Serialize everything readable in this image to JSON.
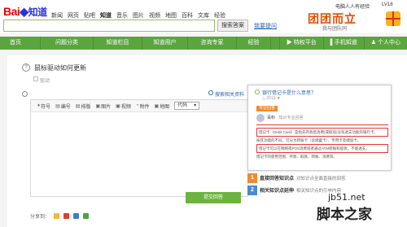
{
  "header": {
    "logo": {
      "part1": "Bai",
      "paw": "◆",
      "part2": "知道"
    },
    "nav": [
      "新闻",
      "网页",
      "贴吧",
      "知道",
      "音乐",
      "图片",
      "视频",
      "地图",
      "百科",
      "文库",
      "经验"
    ],
    "nav_active_index": 3,
    "search": {
      "value": "",
      "button_label": "搜索答案",
      "ask_link": "我要提问"
    },
    "user": {
      "name": "电脑人人有经验",
      "level": "LV18"
    },
    "promo": {
      "text": "团团而立",
      "sub": "我与团队同",
      "badge": "知道"
    }
  },
  "menubar": {
    "items": [
      "首页",
      "问题分类",
      "知道栏目",
      "知道用户",
      "咨询专家",
      "经验"
    ],
    "right_items": [
      "▶ 特权平台",
      "▌手机知道",
      "♟ 个人中心"
    ]
  },
  "question": {
    "icon": "?",
    "title": "鼠标驱动如何更新",
    "meta": "驱动"
  },
  "editor": {
    "related_link": "搜索相关资料",
    "toolbar": [
      {
        "icon": "♦",
        "label": "符号"
      },
      {
        "icon": "▤",
        "label": "编号"
      },
      {
        "icon": "▤",
        "label": "排版"
      },
      {
        "icon": "▣",
        "label": "图片"
      },
      {
        "icon": "▣",
        "label": "视频"
      },
      {
        "icon": "◔",
        "label": "附件"
      },
      {
        "icon": "▣",
        "label": "地图"
      }
    ],
    "code_select": "代码",
    "submit_label": "提交回答"
  },
  "share": {
    "label": "分享到："
  },
  "card": {
    "title": "银行借记卡是什么意思？",
    "meta": "△ 2013  ▼",
    "tag": "专业回答",
    "user": "百科",
    "user_sub": "· 知识专业回答",
    "lines": [
      "借记卡（Debit Card）是指先存款后消费(或取现)没有透支功能的银行卡。",
      "按其功能的不同，可分为转账卡（含储蓄卡）、专用卡及储值卡。",
      "借记卡可以在网络或POS消费或者通过ATM转账和提款，不能透支。",
      "借记卡的使用范围：存款、取款、转账、消费等。"
    ]
  },
  "side": [
    {
      "num": "1",
      "title": "直接回答知识点",
      "desc": "对知识点全面直接的回答"
    },
    {
      "num": "2",
      "title": "相关知识点延伸",
      "desc": "相关知识点的引申内容"
    }
  ],
  "watermark": {
    "url": "jb51.net",
    "cn": "脚本之家"
  }
}
